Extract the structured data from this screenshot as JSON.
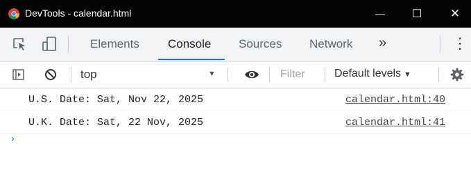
{
  "window": {
    "title": "DevTools - calendar.html",
    "minimize_glyph": "—",
    "maximize_glyph": "☐",
    "close_glyph": "✕"
  },
  "tabs": {
    "items": [
      {
        "label": "Elements"
      },
      {
        "label": "Console"
      },
      {
        "label": "Sources"
      },
      {
        "label": "Network"
      }
    ],
    "overflow": "»",
    "menu": "⋮",
    "active": "Console"
  },
  "toolbar": {
    "context": "top",
    "filter_placeholder": "Filter",
    "levels": "Default levels"
  },
  "console": {
    "messages": [
      {
        "text": "U.S. Date: Sat, Nov 22, 2025",
        "source": "calendar.html:40"
      },
      {
        "text": "U.K. Date: Sat, 22 Nov, 2025",
        "source": "calendar.html:41"
      }
    ],
    "prompt": "›"
  },
  "icons": {
    "logo": "chrome-logo-icon",
    "inspect": "inspect-element-icon",
    "device": "device-toggle-icon",
    "sidebar": "sidebar-toggle-icon",
    "clear": "clear-console-icon",
    "eye": "live-expression-icon",
    "settings": "gear-icon"
  }
}
